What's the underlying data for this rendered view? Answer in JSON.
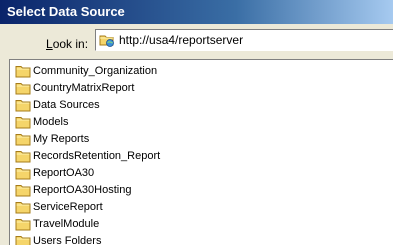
{
  "window": {
    "title": "Select Data Source"
  },
  "look_in": {
    "label_underlined": "L",
    "label_rest": "ook in:",
    "icon": "folder-web-icon",
    "value": "http://usa4/reportserver"
  },
  "folders": [
    {
      "label": "Community_Organization",
      "icon": "folder-icon"
    },
    {
      "label": "CountryMatrixReport",
      "icon": "folder-icon"
    },
    {
      "label": "Data Sources",
      "icon": "folder-icon"
    },
    {
      "label": "Models",
      "icon": "folder-icon"
    },
    {
      "label": "My Reports",
      "icon": "folder-icon"
    },
    {
      "label": "RecordsRetention_Report",
      "icon": "folder-icon"
    },
    {
      "label": "ReportOA30",
      "icon": "folder-icon"
    },
    {
      "label": "ReportOA30Hosting",
      "icon": "folder-icon"
    },
    {
      "label": "ServiceReport",
      "icon": "folder-icon"
    },
    {
      "label": "TravelModule",
      "icon": "folder-icon"
    },
    {
      "label": "Users Folders",
      "icon": "folder-icon"
    }
  ],
  "colors": {
    "title_bar": "#0a246a",
    "dialog_bg": "#ece9d8",
    "folder": "#f5d56a"
  }
}
